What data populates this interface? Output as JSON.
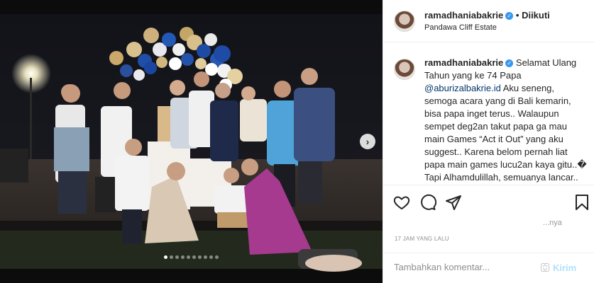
{
  "post": {
    "username": "ramadhaniabakrie",
    "follow_label": "• Diikuti",
    "location": "Pandawa Cliff Estate",
    "caption": {
      "part1": " Selamat Ulang Tahun yang ke 74 Papa ",
      "mention": "@aburizalbakrie.id",
      "part2": " Aku seneng, semoga acara yang di Bali kemarin, bisa papa inget terus.. Walaupun sempet deg2an takut papa ga mau main Games “Act it Out” yang aku suggest.. Karena belom pernah liat papa main games lucu2an kaya gitu..� Tapi Alhamdulillah, semuanya lancar..",
      "tail": "•"
    },
    "likes_partial": "...nya",
    "timestamp": "17 JAM YANG LALU"
  },
  "comment": {
    "placeholder": "Tambahkan komentar...",
    "send_label": "Kirim"
  },
  "carousel": {
    "dot_count": 10,
    "active_index": 0,
    "next_glyph": "›"
  },
  "icons": [
    "verified-badge-icon",
    "heart-icon",
    "comment-icon",
    "share-icon",
    "bookmark-icon",
    "chevron-right-icon",
    "emoji-icon"
  ],
  "colors": {
    "link": "#00376b",
    "verified": "#3897f0",
    "send_disabled": "#b2dffc",
    "muted": "#8e8e8e"
  }
}
